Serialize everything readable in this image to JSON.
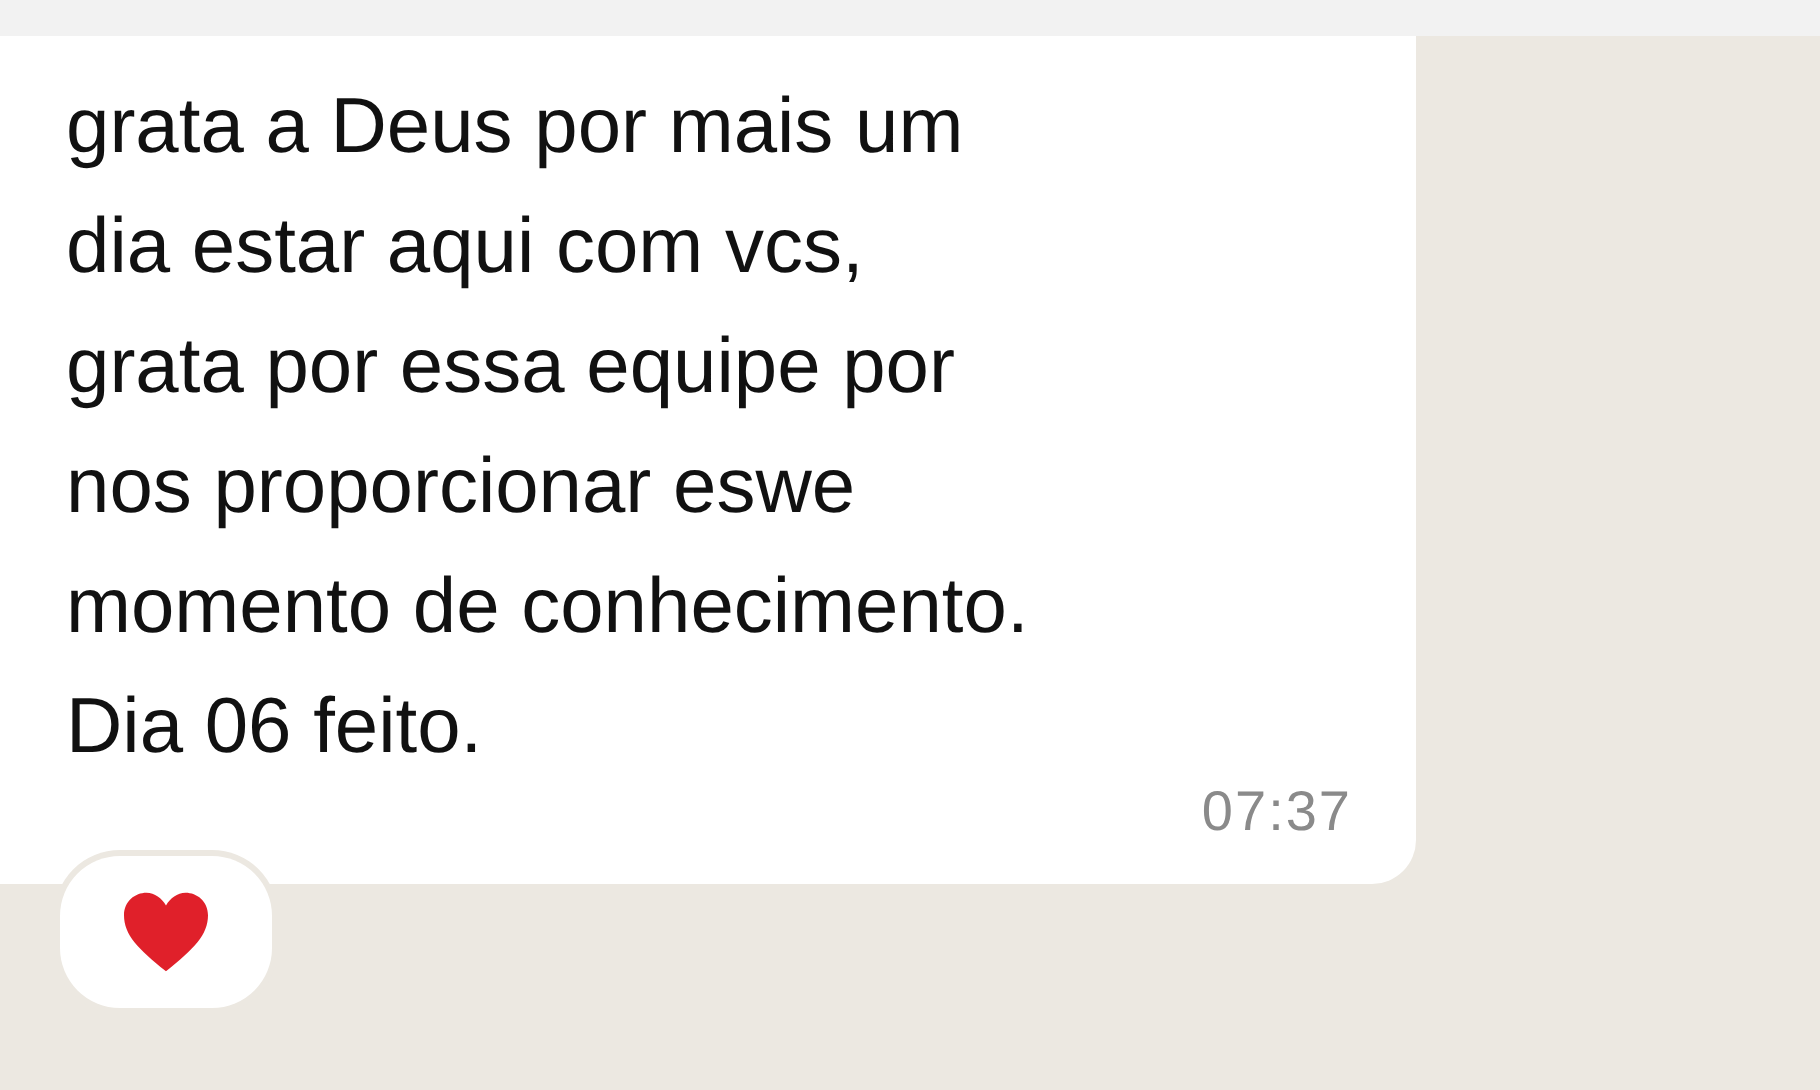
{
  "message": {
    "lines": [
      "grata a Deus por mais um",
      "dia estar aqui com vcs,",
      "grata por essa equipe por",
      "nos proporcionar eswe",
      "momento de conhecimento.",
      "Dia 06 feito."
    ],
    "time": "07:37"
  },
  "reaction": {
    "kind": "heart"
  }
}
